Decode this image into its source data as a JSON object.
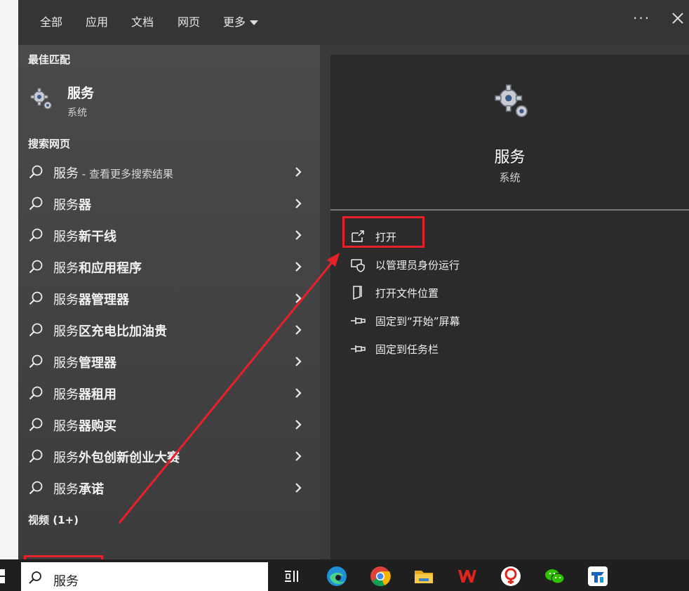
{
  "tabs": [
    {
      "label": "全部"
    },
    {
      "label": "应用"
    },
    {
      "label": "文档"
    },
    {
      "label": "网页"
    },
    {
      "label": "更多"
    }
  ],
  "topbar": {
    "more_dots": "···"
  },
  "best_match": {
    "header": "最佳匹配",
    "title": "服务",
    "subtitle": "系统"
  },
  "web_search": {
    "header": "搜索网页",
    "items": [
      {
        "prefix": "服务",
        "bold": "",
        "suffix": " - 查看更多搜索结果"
      },
      {
        "prefix": "服务",
        "bold": "器",
        "suffix": ""
      },
      {
        "prefix": "服务",
        "bold": "新干线",
        "suffix": ""
      },
      {
        "prefix": "服务",
        "bold": "和应用程序",
        "suffix": ""
      },
      {
        "prefix": "服务",
        "bold": "器管理器",
        "suffix": ""
      },
      {
        "prefix": "服务",
        "bold": "区充电比加油贵",
        "suffix": ""
      },
      {
        "prefix": "服务",
        "bold": "管理器",
        "suffix": ""
      },
      {
        "prefix": "服务",
        "bold": "器租用",
        "suffix": ""
      },
      {
        "prefix": "服务",
        "bold": "器购买",
        "suffix": ""
      },
      {
        "prefix": "服务",
        "bold": "外包创新创业大赛",
        "suffix": ""
      },
      {
        "prefix": "服务",
        "bold": "承诺",
        "suffix": ""
      }
    ]
  },
  "videos": {
    "header": "视频 (1+)"
  },
  "preview": {
    "title": "服务",
    "subtitle": "系统",
    "actions": [
      {
        "label": "打开"
      },
      {
        "label": "以管理员身份运行"
      },
      {
        "label": "打开文件位置"
      },
      {
        "label": "固定到“开始”屏幕"
      },
      {
        "label": "固定到任务栏"
      }
    ]
  },
  "taskbar": {
    "search_value": "服务"
  },
  "colors": {
    "annotation": "#e8202a",
    "panel": "#3a3a3a",
    "preview_bg": "#2b2b2b"
  }
}
